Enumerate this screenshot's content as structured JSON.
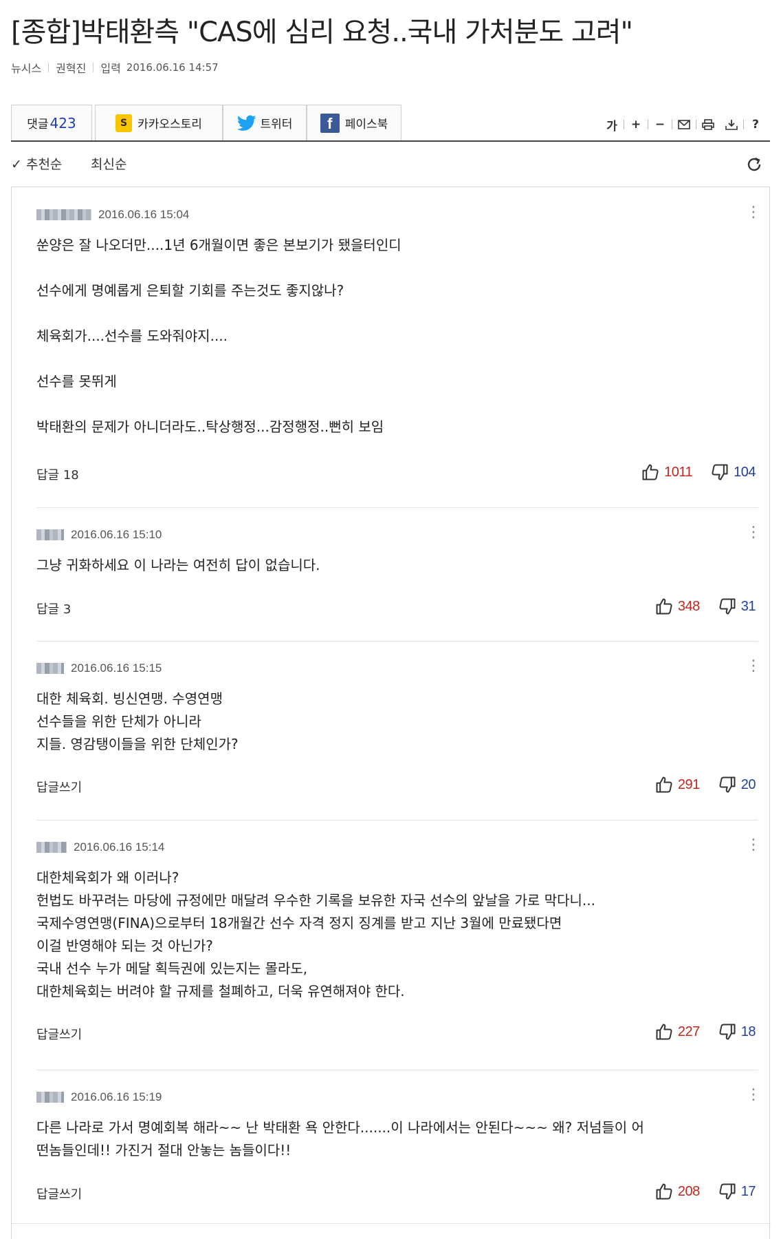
{
  "article": {
    "headline": "[종합]박태환측 \"CAS에 심리 요청..국내 가처분도 고려\"",
    "source": "뉴시스",
    "reporter": "권혁진",
    "date_label": "입력",
    "date": "2016.06.16 14:57"
  },
  "share": {
    "comment_label": "댓글",
    "comment_count": "423",
    "kakao_label": "카카오스토리",
    "twitter_label": "트위터",
    "facebook_label": "페이스북",
    "tools": [
      "가",
      "+",
      "−",
      "✉",
      "🖶",
      "⤓",
      "?"
    ]
  },
  "sort": {
    "recommended": "✓ 추천순",
    "latest": "최신순"
  },
  "comments": [
    {
      "date": "2016.06.16 15:04",
      "lines": [
        "쑨양은 잘 나오더만....1년 6개월이면 좋은 본보기가 됐을터인디",
        "",
        "선수에게 명예롭게 은퇴할 기회를 주는것도 좋지않나?",
        "",
        "체육회가....선수를 도와줘야지....",
        "",
        "선수를 못뛰게",
        "",
        "박태환의 문제가 아니더라도..탁상행정...감정행정..뻔히 보임"
      ],
      "reply": "답글 18",
      "up": "1011",
      "down": "104"
    },
    {
      "date": "2016.06.16 15:10",
      "lines": [
        "그냥 귀화하세요 이 나라는 여전히 답이 없습니다."
      ],
      "reply": "답글 3",
      "up": "348",
      "down": "31"
    },
    {
      "date": "2016.06.16 15:15",
      "lines": [
        "대한 체육회. 빙신연맹. 수영연맹",
        "선수들을 위한 단체가 아니라",
        "지들. 영감탱이들을 위한 단체인가?"
      ],
      "reply": "답글쓰기",
      "up": "291",
      "down": "20"
    },
    {
      "date": "2016.06.16 15:14",
      "lines": [
        "대한체육회가 왜 이러나?",
        "헌법도 바꾸려는 마당에 규정에만 매달려 우수한 기록을 보유한 자국 선수의 앞날을 가로 막다니...",
        "국제수영연맹(FINA)으로부터 18개월간 선수 자격 정지 징계를 받고 지난 3월에 만료됐다면",
        "이걸 반영해야 되는 것 아닌가?",
        "국내 선수 누가 메달 획득권에 있는지는 몰라도,",
        "대한체육회는 버려야 할 규제를 철폐하고, 더욱 유연해져야 한다."
      ],
      "reply": "답글쓰기",
      "up": "227",
      "down": "18"
    },
    {
      "date": "2016.06.16 15:19",
      "lines": [
        "다른 나라로 가서 명예회복 해라~~ 난 박태환 욕 안한다.......이 나라에서는 안된다~~~ 왜? 저넘들이 어",
        "떤놈들인데!! 가진거 절대 안놓는 놈들이다!!"
      ],
      "reply": "답글쓰기",
      "up": "208",
      "down": "17"
    }
  ]
}
